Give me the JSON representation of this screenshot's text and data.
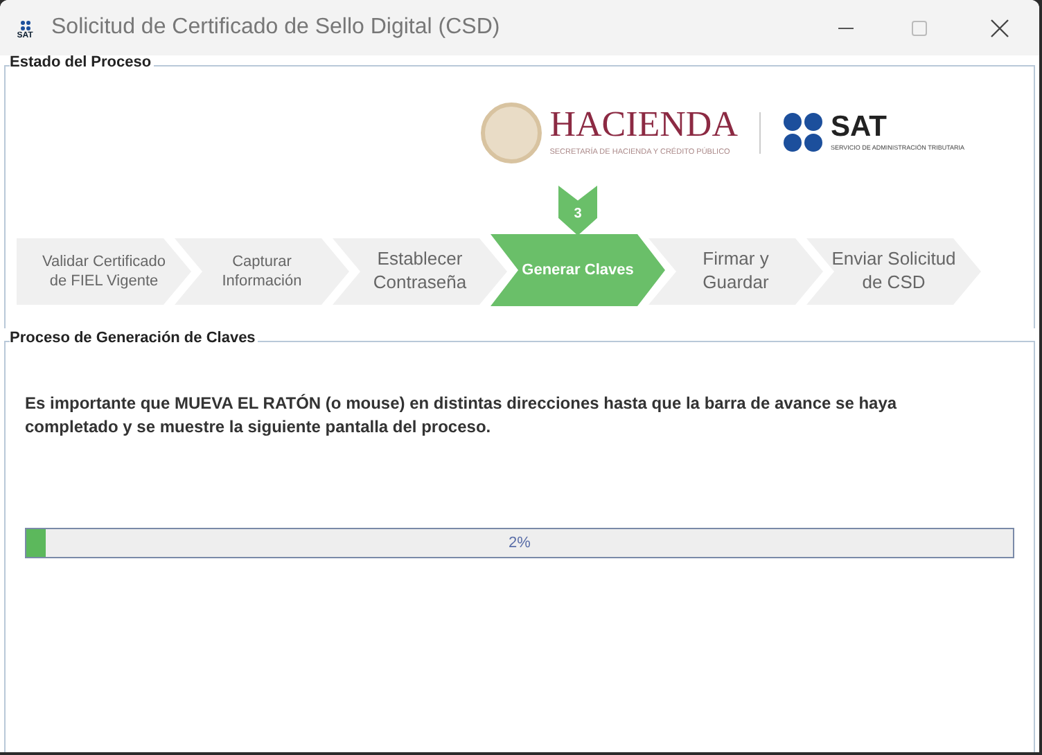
{
  "window": {
    "title": "Solicitud de Certificado de Sello Digital (CSD)",
    "app_icon_text": "SAT"
  },
  "status_group": {
    "title": "Estado del Proceso",
    "hacienda": {
      "name": "HACIENDA",
      "subtitle": "SECRETARÍA DE HACIENDA Y CRÉDITO PÚBLICO"
    },
    "sat": {
      "name": "SAT",
      "subtitle": "SERVICIO DE ADMINISTRACIÓN TRIBUTARIA"
    },
    "step_marker": "3",
    "steps": [
      {
        "label": "Validar Certificado de FIEL Vigente",
        "selected": false
      },
      {
        "label": "Capturar Información",
        "selected": false
      },
      {
        "label": "Establecer Contraseña",
        "selected": false
      },
      {
        "label": "Generar Claves",
        "selected": true
      },
      {
        "label": "Firmar y Guardar",
        "selected": false
      },
      {
        "label": "Enviar Solicitud de CSD",
        "selected": false
      }
    ]
  },
  "process_group": {
    "title": "Proceso de Generación de Claves",
    "message": "Es importante que MUEVA EL RATÓN (o mouse) en distintas direcciones hasta que la barra de avance se haya completado y se muestre la siguiente pantalla del proceso.",
    "progress": {
      "level": 0.02,
      "reading": "2%"
    }
  }
}
